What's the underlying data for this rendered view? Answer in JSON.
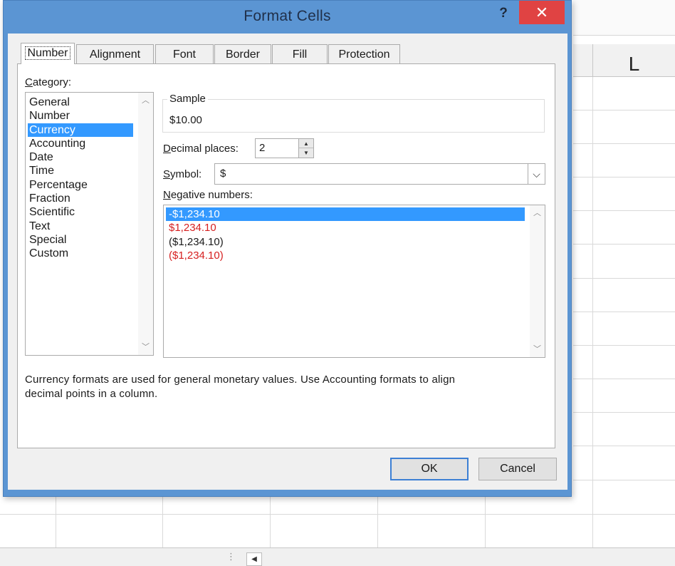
{
  "background_sheet": {
    "column_label": "L"
  },
  "dialog": {
    "title": "Format Cells",
    "help_label": "?",
    "close_label": "✕",
    "tabs": [
      {
        "label": "Number",
        "active": true
      },
      {
        "label": "Alignment",
        "active": false
      },
      {
        "label": "Font",
        "active": false
      },
      {
        "label": "Border",
        "active": false
      },
      {
        "label": "Fill",
        "active": false
      },
      {
        "label": "Protection",
        "active": false
      }
    ],
    "category": {
      "label_prefix": "",
      "label_underlined": "C",
      "label_rest": "ategory:",
      "items": [
        "General",
        "Number",
        "Currency",
        "Accounting",
        "Date",
        "Time",
        "Percentage",
        "Fraction",
        "Scientific",
        "Text",
        "Special",
        "Custom"
      ],
      "selected": "Currency"
    },
    "sample": {
      "title": "Sample",
      "value": "$10.00"
    },
    "decimal_places": {
      "label_underlined": "D",
      "label_rest": "ecimal places:",
      "value": "2"
    },
    "symbol": {
      "label_underlined": "S",
      "label_rest": "ymbol:",
      "value": "$"
    },
    "negative_numbers": {
      "label_underlined": "N",
      "label_rest": "egative numbers:",
      "items": [
        {
          "text": "-$1,234.10",
          "style": "selected"
        },
        {
          "text": "$1,234.10",
          "style": "red"
        },
        {
          "text": "($1,234.10)",
          "style": "normal"
        },
        {
          "text": "($1,234.10)",
          "style": "red"
        }
      ]
    },
    "description_line1": "Currency formats are used for general monetary values.  Use Accounting formats to align",
    "description_line2": "decimal points in a column.",
    "ok_label": "OK",
    "cancel_label": "Cancel"
  },
  "colors": {
    "dialog_frame": "#5b95d3",
    "close_button": "#e04343",
    "selection": "#3399ff",
    "negative_red": "#d61f1f"
  }
}
